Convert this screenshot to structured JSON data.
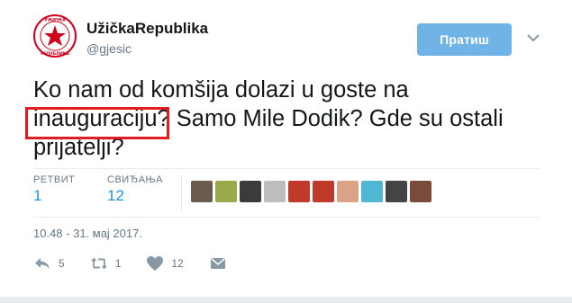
{
  "header": {
    "display_name": "UžičkaRepublika",
    "handle": "@gjesic",
    "follow_label": "Пратиш",
    "avatar_text": [
      "УЖИЧКА",
      "РЕПУБЛИКА"
    ]
  },
  "tweet": {
    "line1": "Ko nam od komšija dolazi u goste na",
    "line2": "inauguraciju? Samo Mile Dodik? Gde su ostali",
    "line3": "prijatelji?"
  },
  "stats": {
    "retweets_label": "РЕТВИТ",
    "retweets_value": "1",
    "likes_label": "СВИЂАЊА",
    "likes_value": "12"
  },
  "liker_avatars": [
    {
      "color": "#6b5a4e"
    },
    {
      "color": "#9aa94a"
    },
    {
      "color": "#3b3b3b"
    },
    {
      "color": "#bdbdbd"
    },
    {
      "color": "#c0392b"
    },
    {
      "color": "#c0392b"
    },
    {
      "color": "#d9a38a"
    },
    {
      "color": "#4fb6d4"
    },
    {
      "color": "#444444"
    },
    {
      "color": "#7a4a3a"
    }
  ],
  "timestamp": "10.48 - 31. мај 2017.",
  "actions": {
    "reply_count": "5",
    "retweet_count": "1",
    "like_count": "12"
  },
  "colors": {
    "follow_bg": "#6fb3e7",
    "stat_value": "#1b95e0",
    "highlight": "#e31b23",
    "muted": "#657786"
  }
}
